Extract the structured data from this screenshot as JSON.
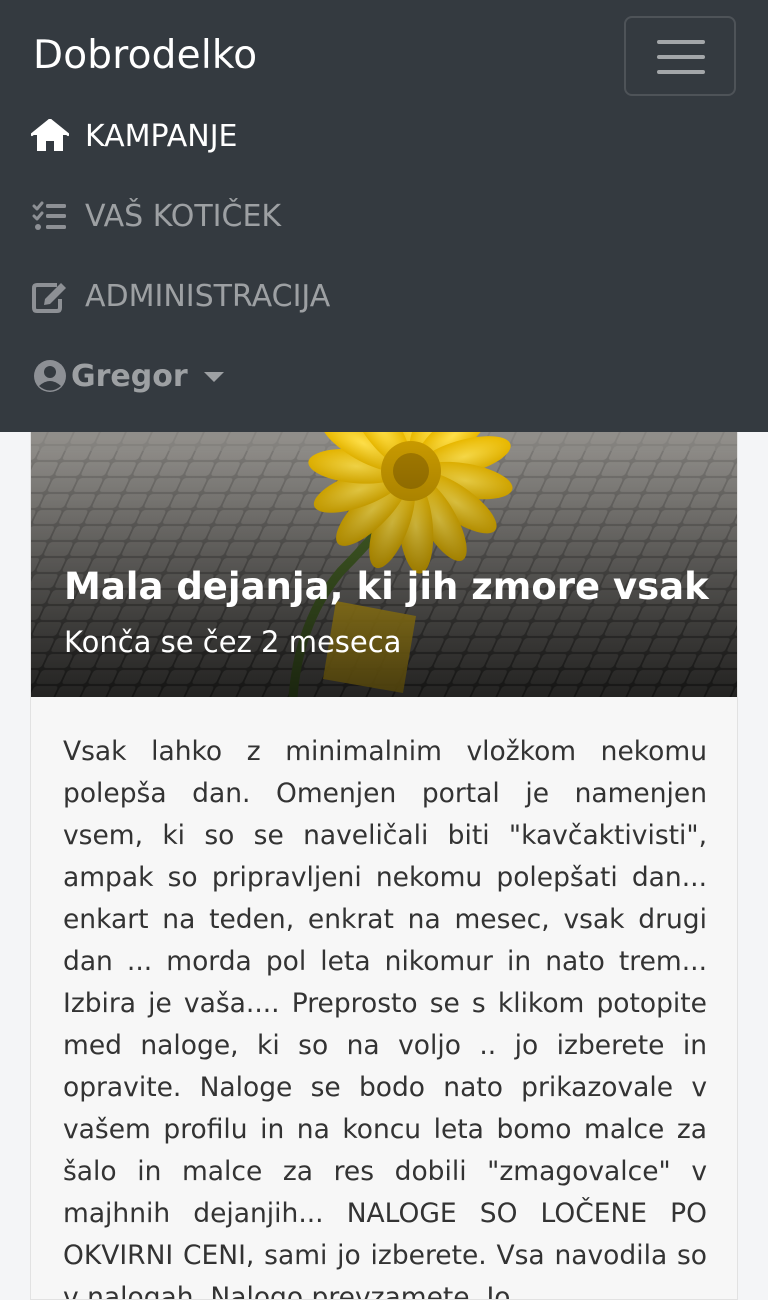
{
  "navbar": {
    "brand": "Dobrodelko",
    "toggler_icon": "hamburger-icon",
    "items": [
      {
        "label": "KAMPANJE",
        "icon": "home-icon",
        "active": true
      },
      {
        "label": "VAŠ KOTIČEK",
        "icon": "tasks-icon",
        "active": false
      },
      {
        "label": "ADMINISTRACIJA",
        "icon": "edit-icon",
        "active": false
      }
    ],
    "user": {
      "label": "Gregor",
      "icon": "user-circle-icon",
      "dropdown": true
    }
  },
  "campaign": {
    "title": "Mala dejanja, ki jih zmore vsak",
    "subtitle": "Konča se čez 2 meseca",
    "description": "Vsak lahko z minimalnim vložkom nekomu polepša dan. Omenjen portal je namenjen vsem, ki so se naveličali biti \"kavčaktivisti\", ampak so pripravljeni nekomu polepšati dan... enkart na teden, enkrat na mesec, vsak drugi dan ... morda pol leta nikomur in nato trem... Izbira je vaša.... Preprosto se s klikom potopite med naloge, ki so na voljo .. jo izberete in opravite. Naloge se bodo nato prikazovale v vašem profilu in na koncu leta bomo malce za šalo in malce za res dobili \"zmagovalce\" v majhnih dejanjih... NALOGE SO LOČENE PO OKVIRNI CENI, sami jo izberete. Vsa navodila so v nalogah. Nalogo prevzamete. Jo"
  },
  "colors": {
    "navbar_bg": "#343a40",
    "active_link": "#ffffff",
    "inactive_link": "#8d9095",
    "card_bg": "#f7f7f7",
    "flower": "#f2c500"
  }
}
